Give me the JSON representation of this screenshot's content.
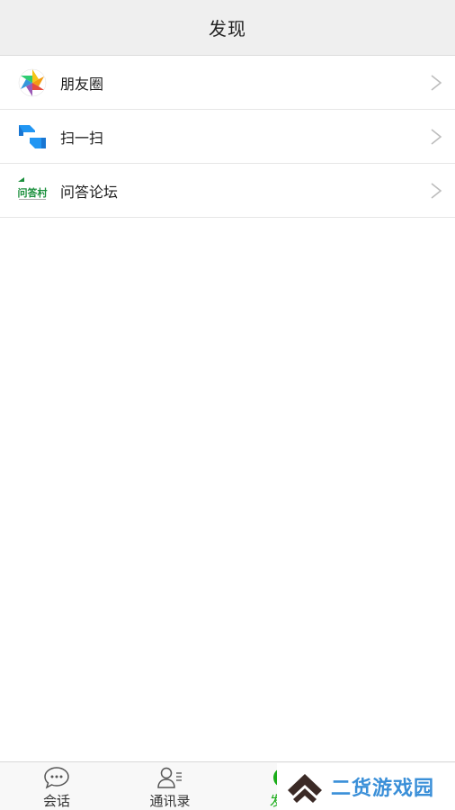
{
  "header": {
    "title": "发现"
  },
  "menu": {
    "items": [
      {
        "label": "朋友圈",
        "icon": "moments-aperture-icon"
      },
      {
        "label": "扫一扫",
        "icon": "scan-icon"
      },
      {
        "label": "问答论坛",
        "icon": "qa-forum-logo-icon",
        "logo_text": "问答村"
      }
    ]
  },
  "tabbar": {
    "tabs": [
      {
        "label": "会话",
        "icon": "chat-bubble-icon"
      },
      {
        "label": "通讯录",
        "icon": "contacts-icon"
      },
      {
        "label": "发现",
        "icon": "discover-icon",
        "active": true
      }
    ]
  },
  "watermark": {
    "text": "二货游戏园",
    "color": "#3a8fd8"
  },
  "colors": {
    "accent": "#1aad19",
    "header_bg": "#efefef"
  }
}
